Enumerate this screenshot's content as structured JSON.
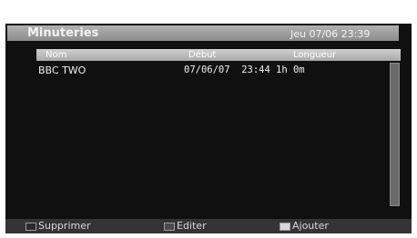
{
  "window": {
    "title": "Minuteries",
    "datetime": "Jeu 07/06 23:39"
  },
  "table": {
    "columns": [
      "Nom",
      "Début",
      "Longueur"
    ],
    "rows": [
      {
        "name": "BBC TWO",
        "start": "07/06/07  23:44",
        "length": "1h 0m"
      }
    ]
  },
  "footer": {
    "delete_label": "Supprimer",
    "edit_label": "Editer",
    "add_label": "Ajouter",
    "colors": {
      "delete": "#2a2a2a",
      "edit": "#4a4a4a",
      "add": "#d8d8d8"
    }
  }
}
